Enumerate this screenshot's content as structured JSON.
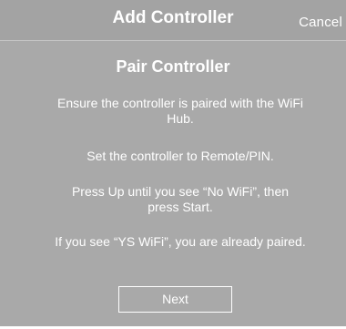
{
  "header": {
    "title": "Add Controller",
    "cancel_label": "Cancel"
  },
  "main": {
    "title": "Pair Controller",
    "instructions": [
      "Ensure the controller is paired with the WiFi Hub.",
      "Set the controller to Remote/PIN.",
      "Press Up until you see “No WiFi”, then press Start.",
      "If you see “YS WiFi”, you are already paired."
    ],
    "next_label": "Next"
  },
  "colors": {
    "background": "#a9a9a9",
    "header_background": "#a3a3a3",
    "text": "#ffffff",
    "divider": "#c6c6c6"
  }
}
